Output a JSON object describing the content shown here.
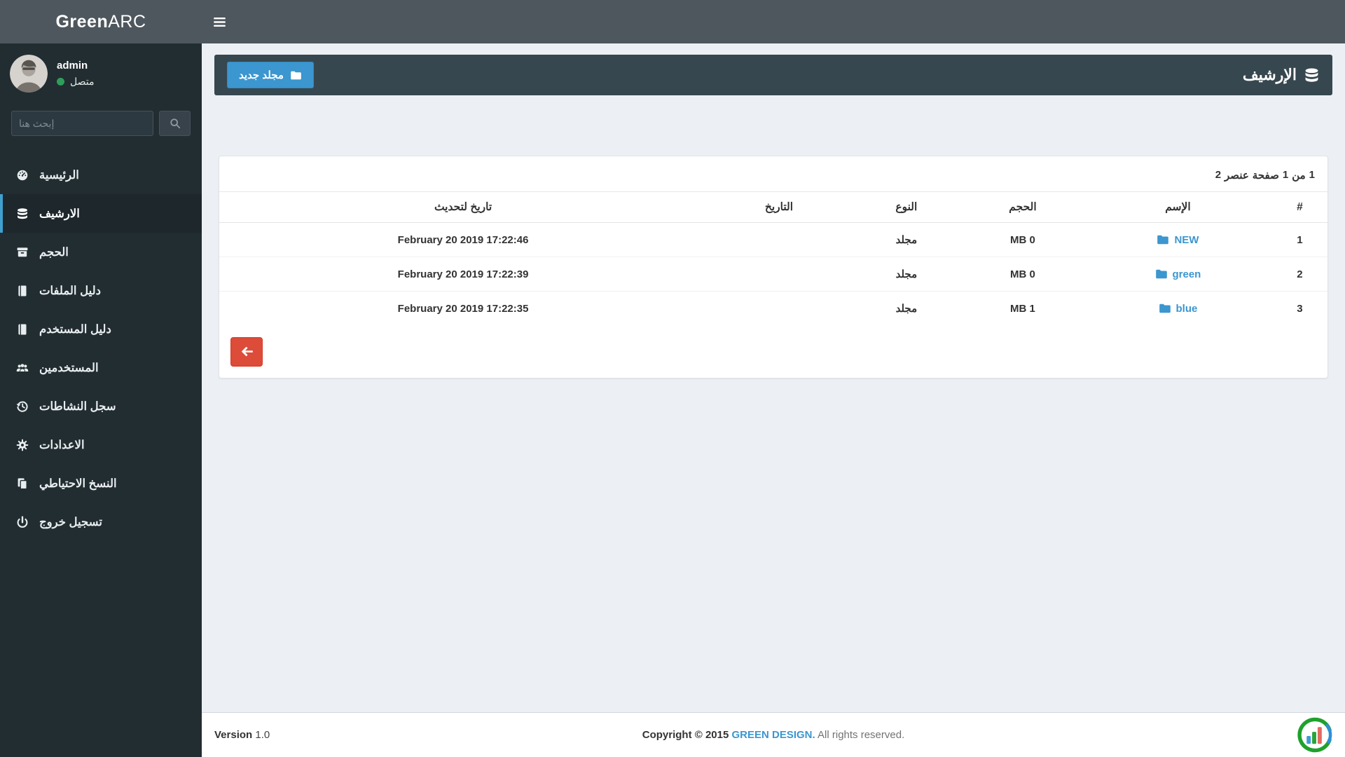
{
  "app": {
    "logo_bold": "Green",
    "logo_light": "ARC"
  },
  "colors": {
    "accent_blue": "#3c96cf",
    "danger_red": "#dd4b39",
    "online_green": "#2e9e5b",
    "sidebar_bg": "#222d32",
    "topbar_bg": "#4e575d",
    "panel_header_bg": "#37474f",
    "content_bg": "#ecf0f5"
  },
  "topbar": {
    "menu_icon": "hamburger-icon"
  },
  "sidebar": {
    "user": {
      "name": "admin",
      "status": "متصل",
      "status_icon": "online-dot"
    },
    "search": {
      "placeholder": "إبحث هنا",
      "icon": "search-icon"
    },
    "items": [
      {
        "label": "الرئيسية",
        "icon": "dashboard-icon",
        "active": false
      },
      {
        "label": "الارشيف",
        "icon": "database-icon",
        "active": true
      },
      {
        "label": "الحجم",
        "icon": "archive-box-icon",
        "active": false
      },
      {
        "label": "دليل الملفات",
        "icon": "book-icon",
        "active": false
      },
      {
        "label": "دليل المستخدم",
        "icon": "book-icon",
        "active": false
      },
      {
        "label": "المستخدمين",
        "icon": "users-icon",
        "active": false
      },
      {
        "label": "سجل النشاطات",
        "icon": "history-icon",
        "active": false
      },
      {
        "label": "الاعدادات",
        "icon": "gear-icon",
        "active": false
      },
      {
        "label": "النسخ الاحتياطي",
        "icon": "copy-icon",
        "active": false
      },
      {
        "label": "تسجيل خروج",
        "icon": "power-icon",
        "active": false
      }
    ]
  },
  "page": {
    "title": "الإرشيف",
    "title_icon": "database-icon",
    "new_folder_button": "مجلد جديد",
    "new_folder_icon": "folder-icon"
  },
  "table": {
    "info": "2 عنصر صفحة 1 من 1",
    "headers": [
      "#",
      "الإسم",
      "الحجم",
      "النوع",
      "التاريخ",
      "تاريخ لتحديث"
    ],
    "rows": [
      {
        "num": "1",
        "name": "NEW",
        "size": "MB 0",
        "type": "مجلد",
        "date": "",
        "updated": "February 20 2019 17:22:46"
      },
      {
        "num": "2",
        "name": "green",
        "size": "MB 0",
        "type": "مجلد",
        "date": "",
        "updated": "February 20 2019 17:22:39"
      },
      {
        "num": "3",
        "name": "blue",
        "size": "MB 1",
        "type": "مجلد",
        "date": "",
        "updated": "February 20 2019 17:22:35"
      }
    ],
    "row_icon": "folder-icon",
    "back_button_icon": "arrow-left-icon"
  },
  "footer": {
    "version_label": "Version",
    "version_value": "1.0",
    "copyright_bold": "Copyright © 2015",
    "brand": "GREEN DESIGN.",
    "rights": "All rights reserved.",
    "brand_logo": "greenarc-circle-logo"
  }
}
